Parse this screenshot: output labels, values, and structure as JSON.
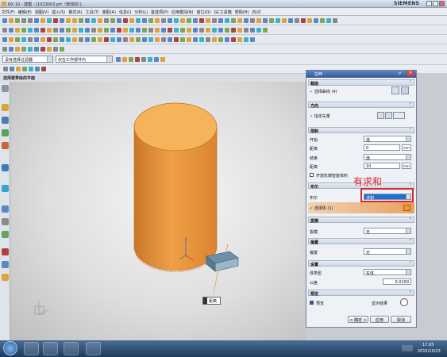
{
  "titlebar": {
    "title": "NX 10 - 建模 - [1023003.prt（修改的）]",
    "brand": "SIEMENS"
  },
  "menu": [
    "文件(F)",
    "编辑(E)",
    "视图(V)",
    "插入(S)",
    "格式(R)",
    "工具(T)",
    "装配(A)",
    "信息(I)",
    "分析(L)",
    "首选项(P)",
    "应用模块(N)",
    "窗口(O)",
    "GC工具箱",
    "帮助(H)",
    "JSUC"
  ],
  "selection": {
    "filter": "没有选择过滤器",
    "scope": "仅在工作部件内"
  },
  "hint": "选择要草绘的平面",
  "viewport": {
    "tag_label": "距离"
  },
  "dialog": {
    "title": "拉伸",
    "section_section": {
      "header": "截面",
      "select_label": "选择曲线 (4)"
    },
    "section_direction": {
      "header": "方向",
      "specify_vector": "指定矢量"
    },
    "section_limits": {
      "header": "限制",
      "start_label": "开始",
      "start_value": "值",
      "dist1_label": "距离",
      "dist1_value": "0",
      "dist1_unit": "mm",
      "end_label": "结束",
      "end_value": "值",
      "dist2_label": "距离",
      "dist2_value": "10",
      "dist2_unit": "mm",
      "open_profile": "开放轮廓智能体积"
    },
    "section_boolean": {
      "header": "布尔",
      "bool_label": "布尔",
      "bool_value": "求和",
      "select_body": "选择体 (1)"
    },
    "section_draft": {
      "header": "拔模",
      "draft_label": "拔模",
      "draft_value": "无"
    },
    "section_offset": {
      "header": "偏置",
      "offset_label": "偏置",
      "offset_value": "无"
    },
    "section_settings": {
      "header": "设置",
      "body_type_label": "体类型",
      "body_type_value": "实体",
      "tolerance_label": "公差",
      "tolerance_value": "0.0100"
    },
    "section_preview": {
      "header": "预览",
      "preview_label": "预览",
      "show_result": "显示结果"
    },
    "buttons": {
      "ok": "< 确定 >",
      "apply": "应用",
      "cancel": "取消"
    }
  },
  "annotation": {
    "text": "有求和"
  },
  "taskbar": {
    "time": "17:05",
    "date": "2015/10/23"
  },
  "colors": {
    "cylinder": "#f0a046",
    "highlight": "#e0262c",
    "dialog_title": "#31599a",
    "boolean_select": "#1e6fd0"
  }
}
